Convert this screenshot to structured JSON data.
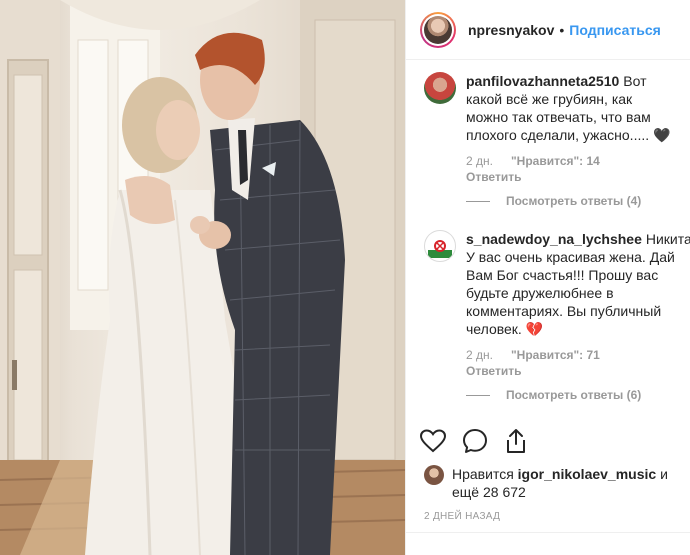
{
  "post": {
    "header": {
      "username": "npresnyakov",
      "separator": "•",
      "follow_label": "Подписаться"
    },
    "comments": [
      {
        "username": "panfilovazhanneta2510",
        "text": "Вот какой всё же грубиян, как можно так отвечать, что вам плохого сделали, ужасно..... 🖤",
        "time": "2 дн.",
        "likes": "\"Нравится\": 14",
        "reply_label": "Ответить",
        "view_replies": "Посмотреть ответы (4)"
      },
      {
        "username": "s_nadewdoy_na_lychshee",
        "text": "Никита!!!! У вас очень красивая жена. Дай Вам Бог счастья!!! Прошу вас будьте дружелюбнее в комментариях. Вы публичный человек. 💔",
        "time": "2 дн.",
        "likes": "\"Нравится\": 71",
        "reply_label": "Ответить",
        "view_replies": "Посмотреть ответы (6)"
      }
    ],
    "actions": {
      "like_icon": "heart-icon",
      "comment_icon": "comment-icon",
      "share_icon": "share-icon"
    },
    "likes_summary": {
      "prefix": "Нравится",
      "user": "igor_nikolaev_music",
      "suffix": "и ещё 28 672"
    },
    "date": "2 ДНЕЙ НАЗАД"
  },
  "colors": {
    "link_blue": "#3897f0",
    "muted": "#999999",
    "text": "#262626"
  }
}
